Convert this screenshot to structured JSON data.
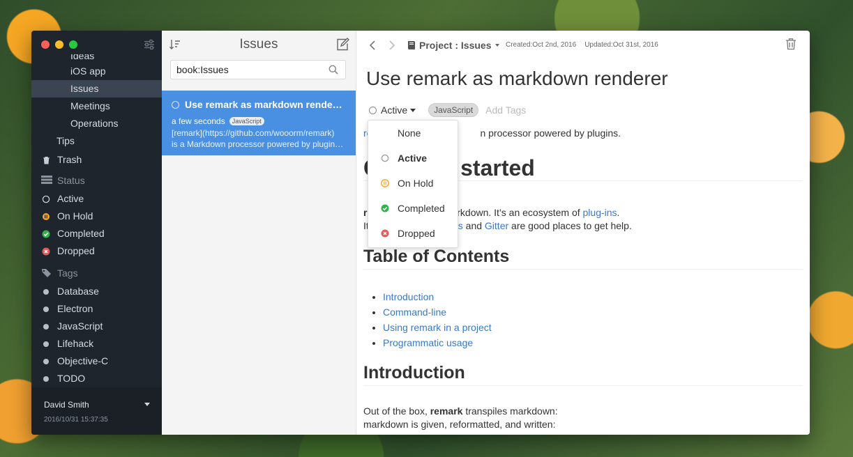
{
  "sidebar": {
    "items": [
      {
        "label": "Ideas"
      },
      {
        "label": "iOS app"
      },
      {
        "label": "Issues"
      },
      {
        "label": "Meetings"
      },
      {
        "label": "Operations"
      },
      {
        "label": "Tips"
      },
      {
        "label": "Trash"
      }
    ],
    "status_header": "Status",
    "statuses": [
      "Active",
      "On Hold",
      "Completed",
      "Dropped"
    ],
    "tags_header": "Tags",
    "tags": [
      "Database",
      "Electron",
      "JavaScript",
      "Lifehack",
      "Objective-C",
      "TODO"
    ],
    "user": "David Smith",
    "timestamp": "2016/10/31 15:37:35"
  },
  "list": {
    "title": "Issues",
    "search_value": "book:Issues",
    "note": {
      "title": "Use remark as markdown rende…",
      "time": "a few seconds",
      "tag": "JavaScript",
      "line1": "[remark](https://github.com/wooorm/remark)",
      "line2": "is a Markdown processor powered by plugin…"
    }
  },
  "main": {
    "breadcrumb": "Project : Issues",
    "created": "Created:Oct 2nd, 2016",
    "updated": "Updated:Oct 31st, 2016",
    "title": "Use remark as markdown renderer",
    "status": "Active",
    "tag": "JavaScript",
    "add_tags_placeholder": "Add Tags",
    "content": {
      "p1_link": "re",
      "p1_rest": "n processor powered by plugins.",
      "h1_pre": "C",
      "h1_rest": "started",
      "p2_pre": "r",
      "p2_mid": "arkdown. It’s an ecosystem of ",
      "p2_link": "plug-ins",
      "p2_end": ".",
      "p3_pre": "It",
      "p3_link1": "s",
      "p3_and": " and ",
      "p3_link2": "Gitter",
      "p3_end": " are good places to get help.",
      "toc_heading": "Table of Contents",
      "toc": [
        "Introduction",
        "Command-line",
        "Using remark in a project",
        "Programmatic usage"
      ],
      "intro_heading": "Introduction",
      "p4_a": "Out of the box, ",
      "p4_b": "remark",
      "p4_c": " transpiles markdown:",
      "p5": "markdown is given, reformatted, and written:"
    }
  },
  "dropdown": {
    "items": [
      "None",
      "Active",
      "On Hold",
      "Completed",
      "Dropped"
    ]
  },
  "colors": {
    "sidebar_bg": "#1f252d",
    "selected_note": "#4a90e2",
    "link": "#3b78c5",
    "on_hold": "#f5a623",
    "completed": "#2fb34a",
    "dropped": "#e05a5a"
  }
}
